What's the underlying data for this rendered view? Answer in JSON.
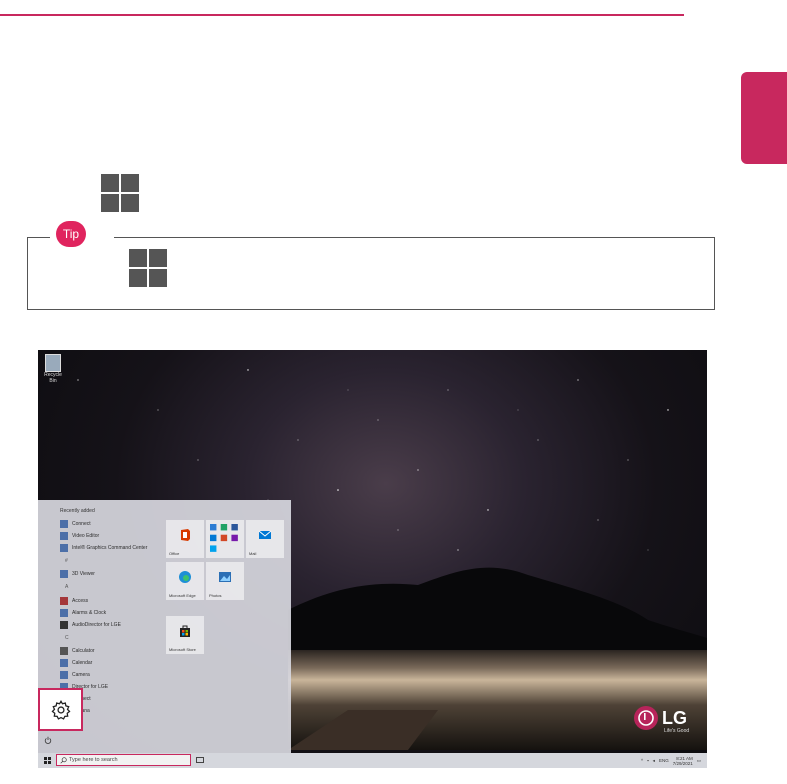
{
  "page": {
    "accent_color": "#c8285e",
    "tip_badge": "Tip"
  },
  "screenshot": {
    "desktop_icon": "Recycle Bin",
    "start_menu": {
      "section_header": "Recently added",
      "items": [
        {
          "label": "Connect",
          "icon": "connect-icon"
        },
        {
          "label": "Video Editor",
          "icon": "video-editor-icon"
        },
        {
          "label": "Intel® Graphics Command Center",
          "icon": "intel-graphics-icon"
        },
        {
          "label": "#",
          "type": "letter"
        },
        {
          "label": "3D Viewer",
          "icon": "3d-viewer-icon"
        },
        {
          "label": "A",
          "type": "letter"
        },
        {
          "label": "Access",
          "icon": "access-icon"
        },
        {
          "label": "Alarms & Clock",
          "icon": "alarm-clock-icon"
        },
        {
          "label": "AudioDirector for LGE",
          "icon": "audiodirector-icon"
        },
        {
          "label": "C",
          "type": "letter"
        },
        {
          "label": "Calculator",
          "icon": "calculator-icon"
        },
        {
          "label": "Calendar",
          "icon": "calendar-icon"
        },
        {
          "label": "Camera",
          "icon": "camera-icon"
        },
        {
          "label": "Director for LGE",
          "icon": "director-icon"
        },
        {
          "label": "Connect",
          "icon": "connect-icon"
        },
        {
          "label": "Cortana",
          "icon": "cortana-icon"
        }
      ],
      "tiles": [
        {
          "label": "Office",
          "icon": "office-icon"
        },
        {
          "label": "",
          "icon": "office-apps-icon"
        },
        {
          "label": "Mail",
          "icon": "mail-icon"
        },
        {
          "label": "Microsoft Edge",
          "icon": "edge-icon"
        },
        {
          "label": "Photos",
          "icon": "photos-icon"
        },
        {
          "label": "Microsoft Store",
          "icon": "store-icon"
        }
      ]
    },
    "taskbar": {
      "search_placeholder": "Type here to search",
      "language": "ENG",
      "time": "8:21 AM",
      "date": "7/29/2021"
    },
    "brand": {
      "logo_text": "LG",
      "tagline": "Life's Good"
    }
  }
}
